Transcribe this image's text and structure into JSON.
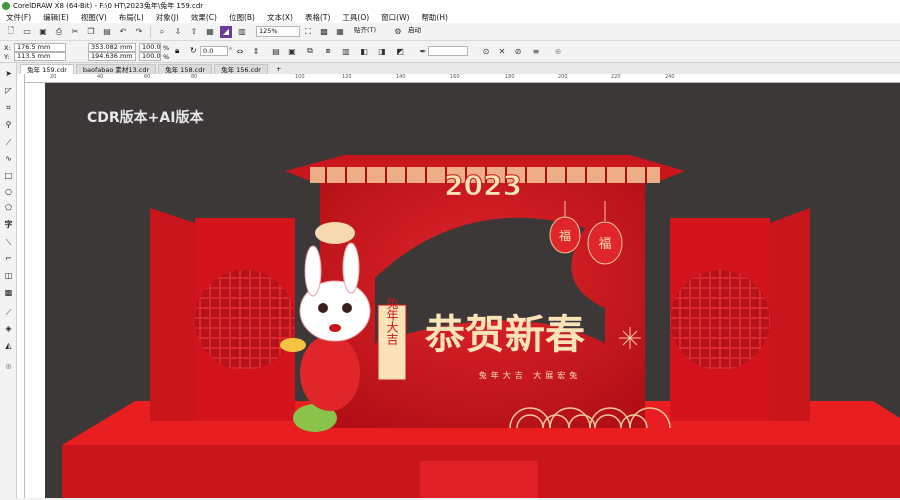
{
  "window": {
    "title": "CorelDRAW X8 (64-Bit) - F:\\0 HT\\2023兔年\\兔年 159.cdr"
  },
  "menu": [
    "文件(F)",
    "编辑(E)",
    "视图(V)",
    "布局(L)",
    "对象(J)",
    "效果(C)",
    "位图(B)",
    "文本(X)",
    "表格(T)",
    "工具(O)",
    "窗口(W)",
    "帮助(H)"
  ],
  "toolbar": {
    "zoom": "125%",
    "snap": "贴齐(T)",
    "launch": "启动"
  },
  "propbar": {
    "x": "176.5 mm",
    "y": "113.5 mm",
    "w": "353.082 mm",
    "h": "194.636 mm",
    "scale_w": "100.0",
    "scale_h": "100.0",
    "scale_unit": "%",
    "angle": "0.0",
    "angle_unit": "°"
  },
  "tabs": [
    {
      "label": "兔年 159.cdr",
      "active": true
    },
    {
      "label": "baofabao 素材13.cdr",
      "active": false
    },
    {
      "label": "兔年 158.cdr",
      "active": false
    },
    {
      "label": "兔年 156.cdr",
      "active": false
    }
  ],
  "ruler": [
    "20",
    "40",
    "60",
    "80",
    "100",
    "120",
    "140",
    "160",
    "180",
    "200",
    "220",
    "240"
  ],
  "artwork": {
    "label": "CDR版本+AI版本",
    "year": "2023",
    "headline": "恭贺新春",
    "sub": "兔年大吉 大展宏兔",
    "scroll": "兔年大吉",
    "lantern": "福"
  },
  "colors": {
    "bg": "#3c3838",
    "red": "#d4141c",
    "dark_red": "#a50f14",
    "gold": "#f2d29a",
    "stage": "#e81e20"
  }
}
